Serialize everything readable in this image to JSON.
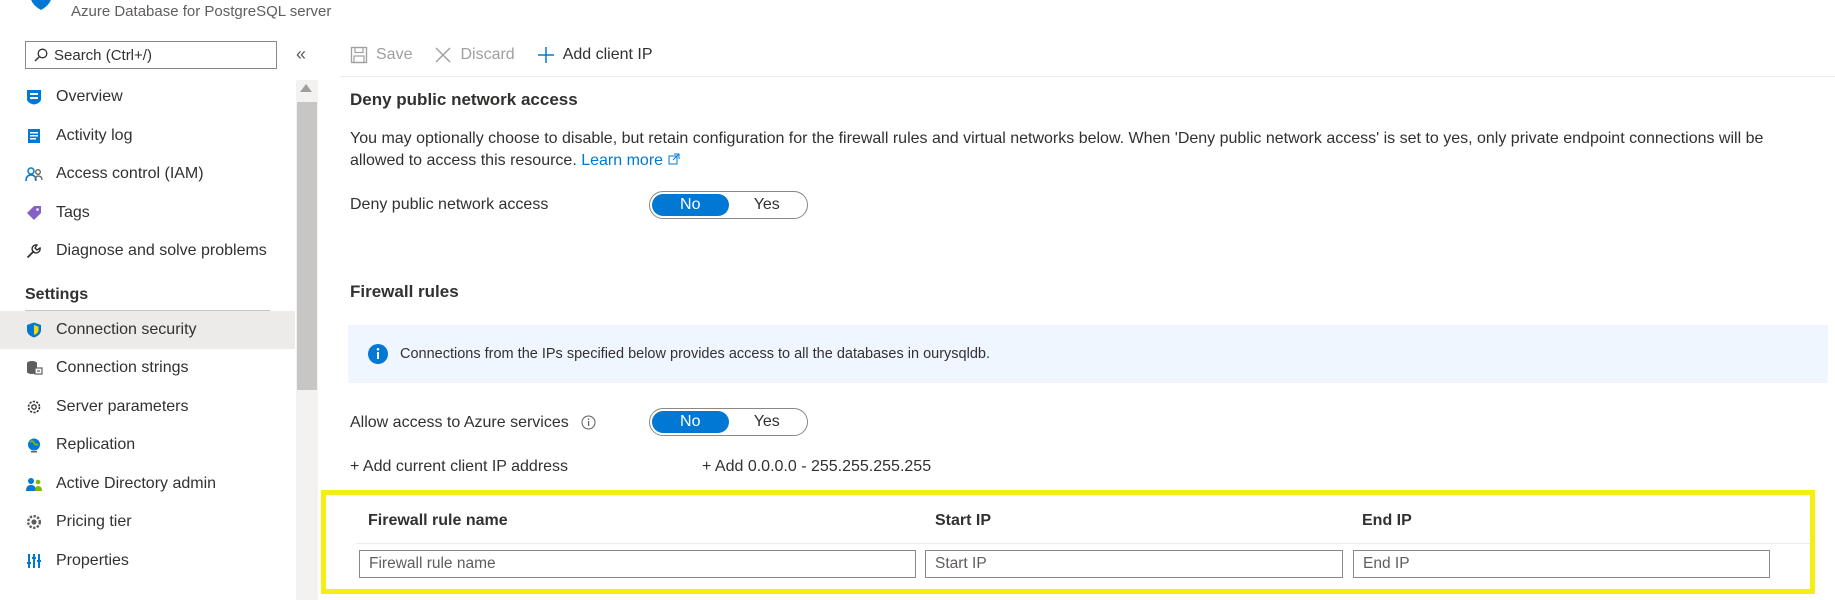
{
  "header": {
    "subtitle": "Azure Database for PostgreSQL server"
  },
  "sidebar": {
    "search_placeholder": "Search (Ctrl+/)",
    "collapse_glyph": "«",
    "items": [
      {
        "label": "Overview",
        "icon": "overview-icon"
      },
      {
        "label": "Activity log",
        "icon": "activity-log-icon"
      },
      {
        "label": "Access control (IAM)",
        "icon": "people-icon"
      },
      {
        "label": "Tags",
        "icon": "tag-icon"
      },
      {
        "label": "Diagnose and solve problems",
        "icon": "wrench-icon"
      }
    ],
    "section_settings": "Settings",
    "settings_items": [
      {
        "label": "Connection security",
        "icon": "shield-icon",
        "active": true
      },
      {
        "label": "Connection strings",
        "icon": "connection-strings-icon"
      },
      {
        "label": "Server parameters",
        "icon": "gear-icon"
      },
      {
        "label": "Replication",
        "icon": "globe-icon"
      },
      {
        "label": "Active Directory admin",
        "icon": "ad-admin-icon"
      },
      {
        "label": "Pricing tier",
        "icon": "pricing-gear-icon"
      },
      {
        "label": "Properties",
        "icon": "properties-bars-icon"
      }
    ]
  },
  "toolbar": {
    "save_label": "Save",
    "discard_label": "Discard",
    "add_client_ip_label": "Add client IP"
  },
  "deny_section": {
    "title": "Deny public network access",
    "description": "You may optionally choose to disable, but retain configuration for the firewall rules and virtual networks below. When 'Deny public network access' is set to yes, only private endpoint connections will be allowed to access this resource.",
    "learn_more": "Learn more",
    "field_label": "Deny public network access",
    "toggle": {
      "no": "No",
      "yes": "Yes",
      "selected": "No"
    }
  },
  "firewall_section": {
    "title": "Firewall rules",
    "info_text": "Connections from the IPs specified below provides access to all the databases in ourysqldb.",
    "allow_azure_label": "Allow access to Azure services",
    "allow_toggle": {
      "no": "No",
      "yes": "Yes",
      "selected": "No"
    },
    "add_current_ip": "+ Add current client IP address",
    "add_all_range": "+ Add 0.0.0.0 - 255.255.255.255",
    "columns": [
      "Firewall rule name",
      "Start IP",
      "End IP"
    ],
    "placeholders": {
      "rule_name": "Firewall rule name",
      "start_ip": "Start IP",
      "end_ip": "End IP"
    }
  },
  "colors": {
    "accent": "#0078d4",
    "highlight": "#f5ee11",
    "info_bg": "#f0f6ff"
  }
}
